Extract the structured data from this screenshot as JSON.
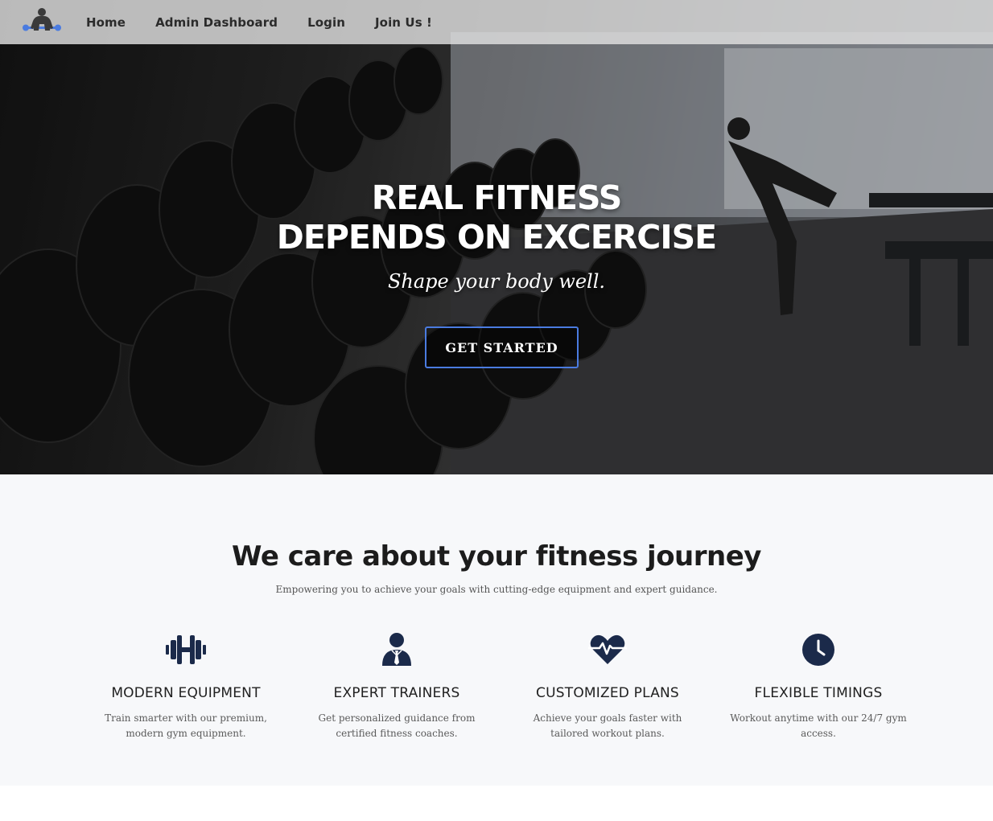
{
  "colors": {
    "accent": "#4a7be0",
    "icon_navy": "#1b2a4a",
    "features_bg": "#f7f8fa"
  },
  "nav": {
    "logo_icon": "bodybuilder-logo-icon",
    "links": [
      {
        "label": "Home"
      },
      {
        "label": "Admin Dashboard"
      },
      {
        "label": "Login"
      },
      {
        "label": "Join Us !"
      }
    ]
  },
  "hero": {
    "title_line1": "REAL FITNESS",
    "title_line2": "DEPENDS ON EXCERCISE",
    "subtitle": "Shape your body well.",
    "cta_label": "GET STARTED"
  },
  "features": {
    "title": "We care about your fitness journey",
    "subtitle": "Empowering you to achieve your goals with cutting-edge equipment and expert guidance.",
    "items": [
      {
        "icon": "dumbbell-icon",
        "title": "MODERN EQUIPMENT",
        "desc": "Train smarter with our premium, modern gym equipment."
      },
      {
        "icon": "trainer-icon",
        "title": "EXPERT TRAINERS",
        "desc": "Get personalized guidance from certified fitness coaches."
      },
      {
        "icon": "heartbeat-icon",
        "title": "CUSTOMIZED PLANS",
        "desc": "Achieve your goals faster with tailored workout plans."
      },
      {
        "icon": "clock-icon",
        "title": "FLEXIBLE TIMINGS",
        "desc": "Workout anytime with our 24/7 gym access."
      }
    ]
  }
}
